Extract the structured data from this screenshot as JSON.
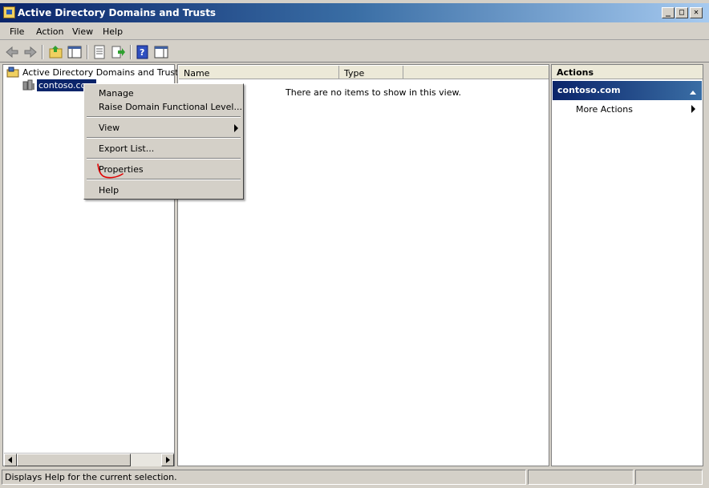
{
  "window": {
    "title": "Active Directory Domains and Trusts",
    "caption_buttons": {
      "minimize": "_",
      "maximize": "□",
      "close": "✕"
    }
  },
  "menu": {
    "items": [
      "File",
      "Action",
      "View",
      "Help"
    ]
  },
  "toolbar": {
    "icons": [
      "back-arrow-icon",
      "forward-arrow-icon",
      "up-folder-icon",
      "show-hide-console-tree-icon",
      "properties-icon",
      "export-list-icon",
      "help-icon",
      "show-hide-action-pane-icon"
    ]
  },
  "tree": {
    "root_label": "Active Directory Domains and Trusts [S",
    "child_label": "contoso.com"
  },
  "list": {
    "columns": [
      "Name",
      "Type"
    ],
    "empty_message": "There are no items to show in this view."
  },
  "actions": {
    "header": "Actions",
    "section_title": "contoso.com",
    "items": [
      {
        "label": "More Actions"
      }
    ]
  },
  "context_menu": {
    "items": [
      {
        "label": "Manage"
      },
      {
        "label": "Raise Domain Functional Level..."
      },
      {
        "label": "View"
      },
      {
        "label": "Export List..."
      },
      {
        "label": "Properties"
      },
      {
        "label": "Help"
      }
    ]
  },
  "status": {
    "text": "Displays Help for the current selection."
  },
  "colors": {
    "selection": "#0a246a",
    "annotation_red": "#e00000",
    "face": "#d4d0c8"
  }
}
